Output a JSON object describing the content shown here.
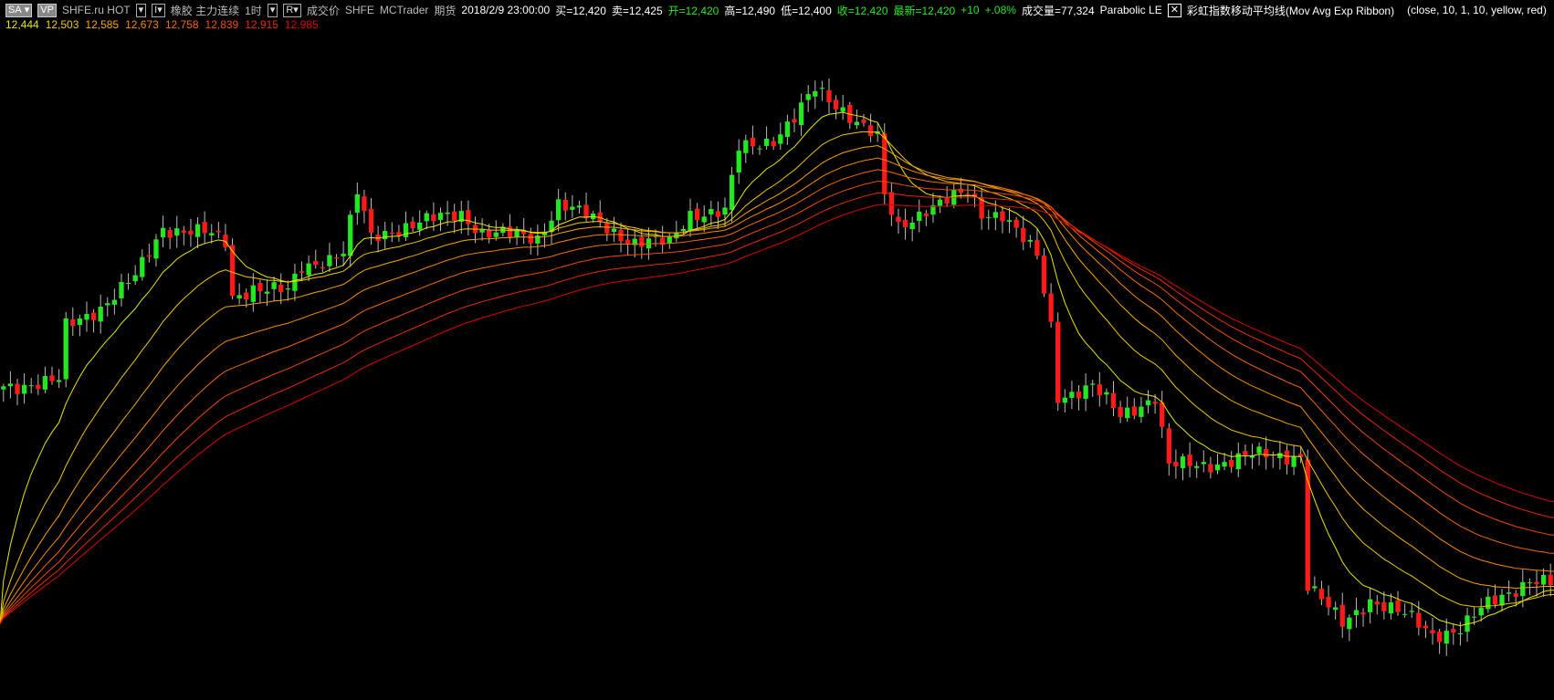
{
  "header": {
    "sa_label": "SA",
    "vp_label": "VP",
    "source": "SHFE.ru HOT",
    "i_btn": "I",
    "symbol": "橡胶 主力连续",
    "interval": "1时",
    "r_btn": "R",
    "price_type": "成交价",
    "exchange": "SHFE",
    "platform": "MCTrader",
    "market": "期货",
    "datetime": "2018/2/9  23:00:00",
    "bid": "买=12,420",
    "ask": "卖=12,425",
    "open": "开=12,420",
    "high": "高=12,490",
    "low": "低=12,400",
    "close": "收=12,420",
    "last": "最新=12,420",
    "change": "+10",
    "change_pct": "+.08%",
    "volume": "成交量=77,324",
    "strategy": "Parabolic LE",
    "close_x": "✕",
    "indicator": "彩虹指数移动平均线(Mov Avg Exp Ribbon)",
    "indicator_params": "(close,  10,  1,  10,  yellow,  red)"
  },
  "ribbon_values": [
    {
      "text": "12,444",
      "color": "#e8e800"
    },
    {
      "text": "12,503",
      "color": "#f0c800"
    },
    {
      "text": "12,585",
      "color": "#f5a800"
    },
    {
      "text": "12,673",
      "color": "#f58a00"
    },
    {
      "text": "12,758",
      "color": "#f56a00"
    },
    {
      "text": "12,839",
      "color": "#f04a00"
    },
    {
      "text": "12,915",
      "color": "#e82a00"
    },
    {
      "text": "12,985",
      "color": "#e00000"
    }
  ],
  "chart_data": {
    "type": "candlestick",
    "bars": 224,
    "price_range": [
      10554,
      21860
    ],
    "ema_periods": [
      10,
      20,
      30,
      40,
      50,
      60,
      70,
      80
    ],
    "ema_seed": 11780,
    "up_color": "#22e822",
    "down_color": "#ff1a1a",
    "anchors": [
      [
        0,
        15620
      ],
      [
        8,
        15700
      ],
      [
        9,
        16580
      ],
      [
        14,
        16900
      ],
      [
        19,
        17380
      ],
      [
        23,
        18180
      ],
      [
        29,
        18100
      ],
      [
        32,
        17940
      ],
      [
        33,
        17060
      ],
      [
        36,
        17220
      ],
      [
        41,
        17140
      ],
      [
        43,
        17540
      ],
      [
        49,
        17780
      ],
      [
        51,
        18740
      ],
      [
        53,
        18020
      ],
      [
        57,
        18180
      ],
      [
        66,
        18420
      ],
      [
        69,
        18100
      ],
      [
        77,
        18020
      ],
      [
        80,
        18580
      ],
      [
        86,
        18260
      ],
      [
        91,
        17940
      ],
      [
        96,
        17940
      ],
      [
        99,
        18420
      ],
      [
        104,
        18420
      ],
      [
        106,
        19460
      ],
      [
        111,
        19620
      ],
      [
        114,
        19940
      ],
      [
        117,
        20420
      ],
      [
        121,
        20100
      ],
      [
        126,
        19620
      ],
      [
        127,
        18660
      ],
      [
        129,
        18180
      ],
      [
        133,
        18500
      ],
      [
        139,
        18740
      ],
      [
        141,
        18420
      ],
      [
        144,
        18420
      ],
      [
        149,
        17700
      ],
      [
        151,
        16580
      ],
      [
        152,
        15460
      ],
      [
        157,
        15620
      ],
      [
        161,
        15140
      ],
      [
        166,
        15460
      ],
      [
        168,
        14340
      ],
      [
        173,
        14340
      ],
      [
        180,
        14500
      ],
      [
        187,
        14500
      ],
      [
        188,
        12420
      ],
      [
        193,
        11780
      ],
      [
        197,
        12180
      ],
      [
        203,
        11860
      ],
      [
        206,
        11620
      ],
      [
        210,
        11700
      ],
      [
        214,
        12100
      ],
      [
        220,
        12500
      ],
      [
        223,
        12420
      ]
    ]
  }
}
